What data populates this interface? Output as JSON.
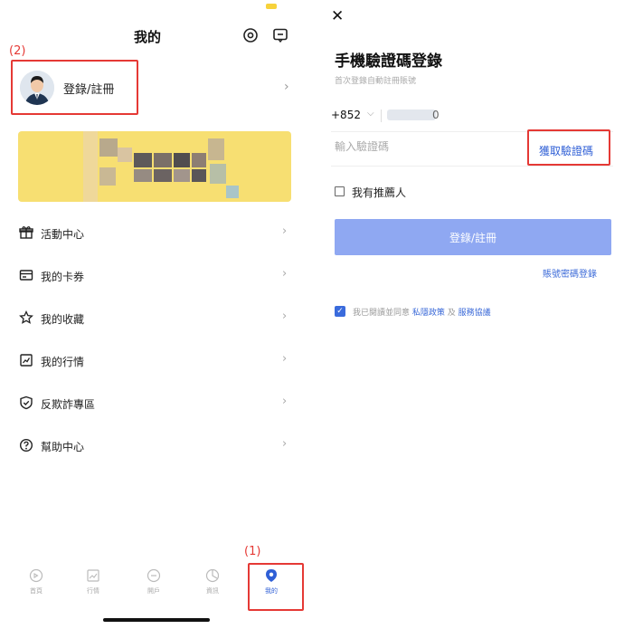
{
  "left": {
    "title": "我的",
    "annotation_2": "(2)",
    "annotation_1": "(1)",
    "login_label": "登錄/註冊",
    "chevron": "›",
    "menu": [
      {
        "label": "活動中心",
        "icon": "gift-icon"
      },
      {
        "label": "我的卡券",
        "icon": "card-icon"
      },
      {
        "label": "我的收藏",
        "icon": "star-icon"
      },
      {
        "label": "我的行情",
        "icon": "chart-icon"
      },
      {
        "label": "反欺詐專區",
        "icon": "shield-icon"
      },
      {
        "label": "幫助中心",
        "icon": "help-icon"
      }
    ],
    "tabs": [
      {
        "label": "首頁",
        "icon": "home-icon"
      },
      {
        "label": "行情",
        "icon": "market-icon"
      },
      {
        "label": "開戶",
        "icon": "account-icon"
      },
      {
        "label": "資訊",
        "icon": "news-icon"
      },
      {
        "label": "我的",
        "icon": "profile-icon"
      }
    ],
    "accent_color": "#2f5fd6",
    "highlight_color": "#e53935"
  },
  "right": {
    "close": "✕",
    "title": "手機驗證碼登錄",
    "subtitle": "首次登錄自動註冊賬號",
    "country_code": "+852",
    "phone_suffix": "0",
    "code_placeholder": "輸入驗證碼",
    "get_code": "獲取驗證碼",
    "referral_label": "我有推薦人",
    "login_button": "登錄/註冊",
    "password_login": "賬號密碼登錄",
    "agree_prefix": "我已閱讀並同意",
    "privacy": "私隱政策",
    "and": "及",
    "terms": "服務協議",
    "button_color": "#8fa8f2"
  }
}
